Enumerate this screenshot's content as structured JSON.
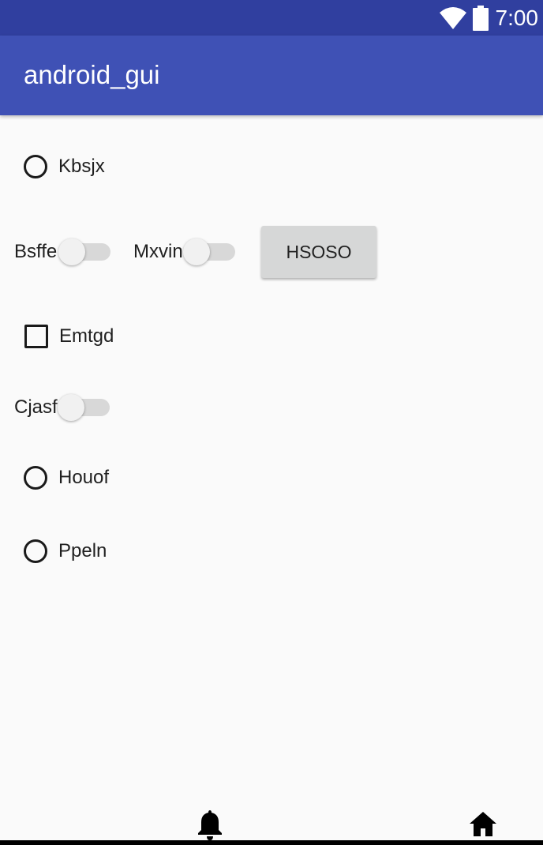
{
  "status_bar": {
    "time": "7:00",
    "wifi_icon": "wifi-icon",
    "battery_icon": "battery-icon"
  },
  "app_bar": {
    "title": "android_gui"
  },
  "controls": {
    "radio_kbsjx": {
      "label": "Kbsjx",
      "checked": false
    },
    "switch_bsffe": {
      "label": "Bsffe",
      "on": false
    },
    "switch_mxvin": {
      "label": "Mxvin",
      "on": false
    },
    "button_hsoso": {
      "label": "HSOSO"
    },
    "checkbox_emtgd": {
      "label": "Emtgd",
      "checked": false
    },
    "switch_cjasf": {
      "label": "Cjasf",
      "on": false
    },
    "radio_houof": {
      "label": "Houof",
      "checked": false
    },
    "radio_ppeln": {
      "label": "Ppeln",
      "checked": false
    }
  },
  "bottom_nav": {
    "left_icon": "bell-icon",
    "right_icon": "home-icon"
  },
  "colors": {
    "status_bar": "#303f9f",
    "app_bar": "#3f51b5",
    "background": "#fafafa",
    "button": "#d6d7d7"
  }
}
